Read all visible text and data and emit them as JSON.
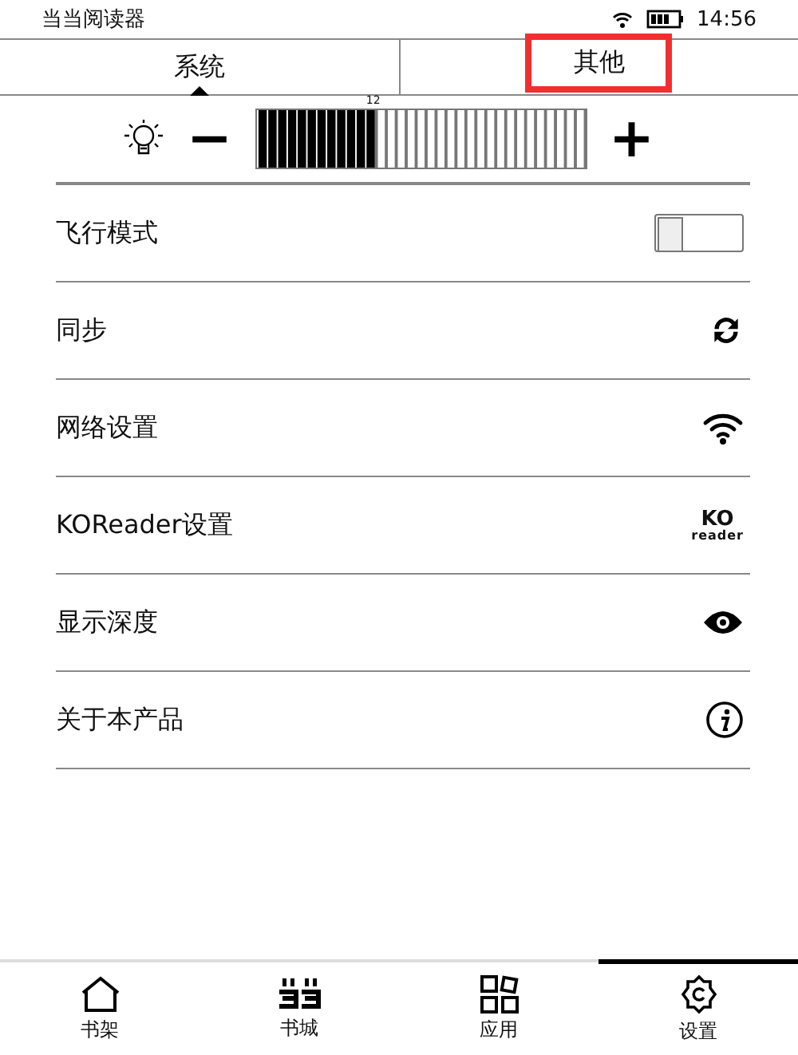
{
  "status_bar": {
    "app_name": "当当阅读器",
    "time": "14:56"
  },
  "tabs": [
    {
      "label": "系统",
      "selected": true,
      "highlighted": false
    },
    {
      "label": "其他",
      "selected": false,
      "highlighted": true
    }
  ],
  "brightness": {
    "minus": "−",
    "plus": "+",
    "reading": "12",
    "level": 0.3636
  },
  "settings": [
    {
      "kind": "toggle",
      "label": "飞行模式",
      "on": false
    },
    {
      "kind": "sync",
      "label": "同步"
    },
    {
      "kind": "wifi",
      "label": "网络设置"
    },
    {
      "kind": "koreader",
      "label": "KOReader设置",
      "logo_top": "KO",
      "logo_bottom": "reader"
    },
    {
      "kind": "eye",
      "label": "显示深度"
    },
    {
      "kind": "info",
      "label": "关于本产品"
    }
  ],
  "bottom_nav": [
    {
      "kind": "home",
      "label": "书架",
      "selected": false
    },
    {
      "kind": "store",
      "label": "书城",
      "selected": false
    },
    {
      "kind": "apps",
      "label": "应用",
      "selected": false
    },
    {
      "kind": "gear",
      "label": "设置",
      "selected": true
    }
  ]
}
